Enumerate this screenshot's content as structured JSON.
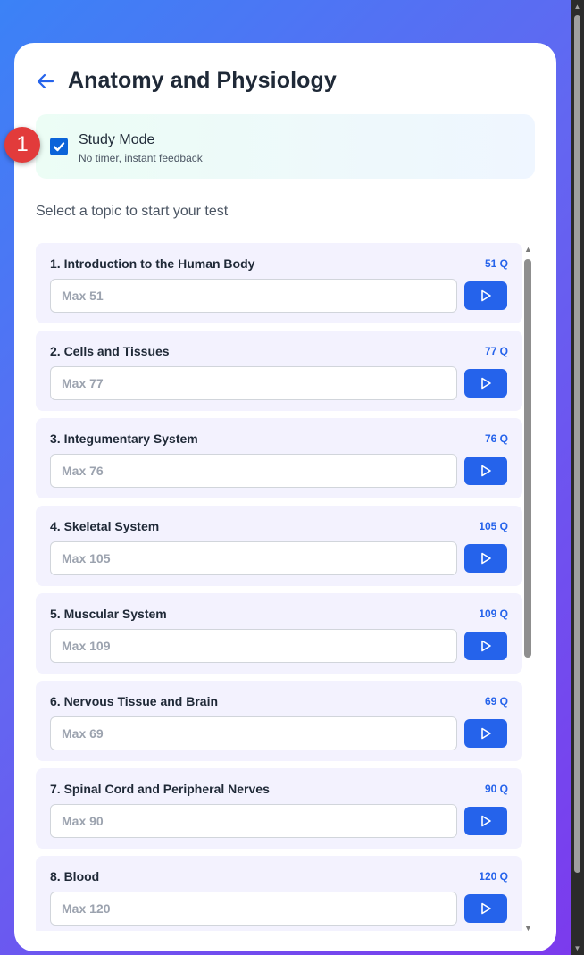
{
  "header": {
    "title": "Anatomy and Physiology"
  },
  "study_mode": {
    "label": "Study Mode",
    "description": "No timer, instant feedback",
    "checked": true
  },
  "annotation": {
    "badge": "1"
  },
  "prompt": "Select a topic to start your test",
  "topics": [
    {
      "name": "1. Introduction to the Human Body",
      "count": "51 Q",
      "placeholder": "Max 51"
    },
    {
      "name": "2. Cells and Tissues",
      "count": "77 Q",
      "placeholder": "Max 77"
    },
    {
      "name": "3. Integumentary System",
      "count": "76 Q",
      "placeholder": "Max 76"
    },
    {
      "name": "4. Skeletal System",
      "count": "105 Q",
      "placeholder": "Max 105"
    },
    {
      "name": "5. Muscular System",
      "count": "109 Q",
      "placeholder": "Max 109"
    },
    {
      "name": "6. Nervous Tissue and Brain",
      "count": "69 Q",
      "placeholder": "Max 69"
    },
    {
      "name": "7. Spinal Cord and Peripheral Nerves",
      "count": "90 Q",
      "placeholder": "Max 90"
    },
    {
      "name": "8. Blood",
      "count": "120 Q",
      "placeholder": "Max 120"
    }
  ],
  "icons": {
    "back": "arrow-left-icon",
    "play": "play-icon",
    "check": "checkmark-icon"
  },
  "colors": {
    "accent": "#2563eb",
    "checkbox": "#0b63d9",
    "badge": "#e23b3b",
    "topic_bg": "#f3f2fe"
  }
}
